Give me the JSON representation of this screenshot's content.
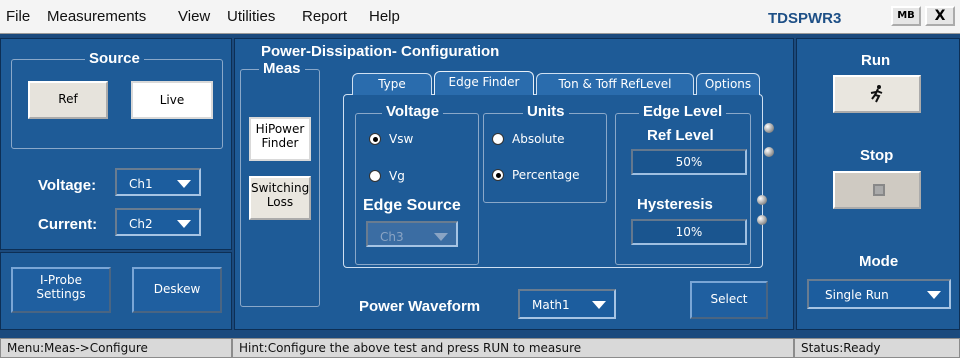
{
  "menu": {
    "file": "File",
    "measurements": "Measurements",
    "view": "View",
    "utilities": "Utilities",
    "report": "Report",
    "help": "Help"
  },
  "app_title": "TDSPWR3",
  "window_buttons": {
    "minimize": "MB",
    "close": "X"
  },
  "source": {
    "title": "Source",
    "ref_label": "Ref",
    "live_label": "Live",
    "voltage_label": "Voltage:",
    "voltage_value": "Ch1",
    "current_label": "Current:",
    "current_value": "Ch2"
  },
  "buttons": {
    "iprobe_line1": "I-Probe",
    "iprobe_line2": "Settings",
    "deskew": "Deskew",
    "select": "Select"
  },
  "config": {
    "title": "Power-Dissipation- Configuration",
    "meas_title": "Meas",
    "hipower_line1": "HiPower",
    "hipower_line2": "Finder",
    "switching_line1": "Switching",
    "switching_line2": "Loss",
    "tabs": [
      "Type",
      "Edge Finder",
      "Ton & Toff RefLevel",
      "Options"
    ],
    "voltage_title": "Voltage",
    "vsw_label": "Vsw",
    "vg_label": "Vg",
    "edge_source_title": "Edge Source",
    "edge_source_value": "Ch3",
    "units_title": "Units",
    "absolute_label": "Absolute",
    "percentage_label": "Percentage",
    "edge_level_title": "Edge Level",
    "ref_level_title": "Ref Level",
    "ref_level_value": "50%",
    "hysteresis_title": "Hysteresis",
    "hysteresis_value": "10%",
    "power_waveform_label": "Power Waveform",
    "power_waveform_value": "Math1"
  },
  "run_panel": {
    "run_label": "Run",
    "stop_label": "Stop",
    "mode_label": "Mode",
    "mode_value": "Single Run"
  },
  "status": {
    "menu": "Menu:Meas->Configure",
    "hint": "Hint:Configure the above test and press RUN to measure",
    "state": "Status:Ready"
  },
  "colors": {
    "panel": "#1e5b97",
    "background": "#1b4a7d",
    "title_accent": "#1d4f86"
  }
}
